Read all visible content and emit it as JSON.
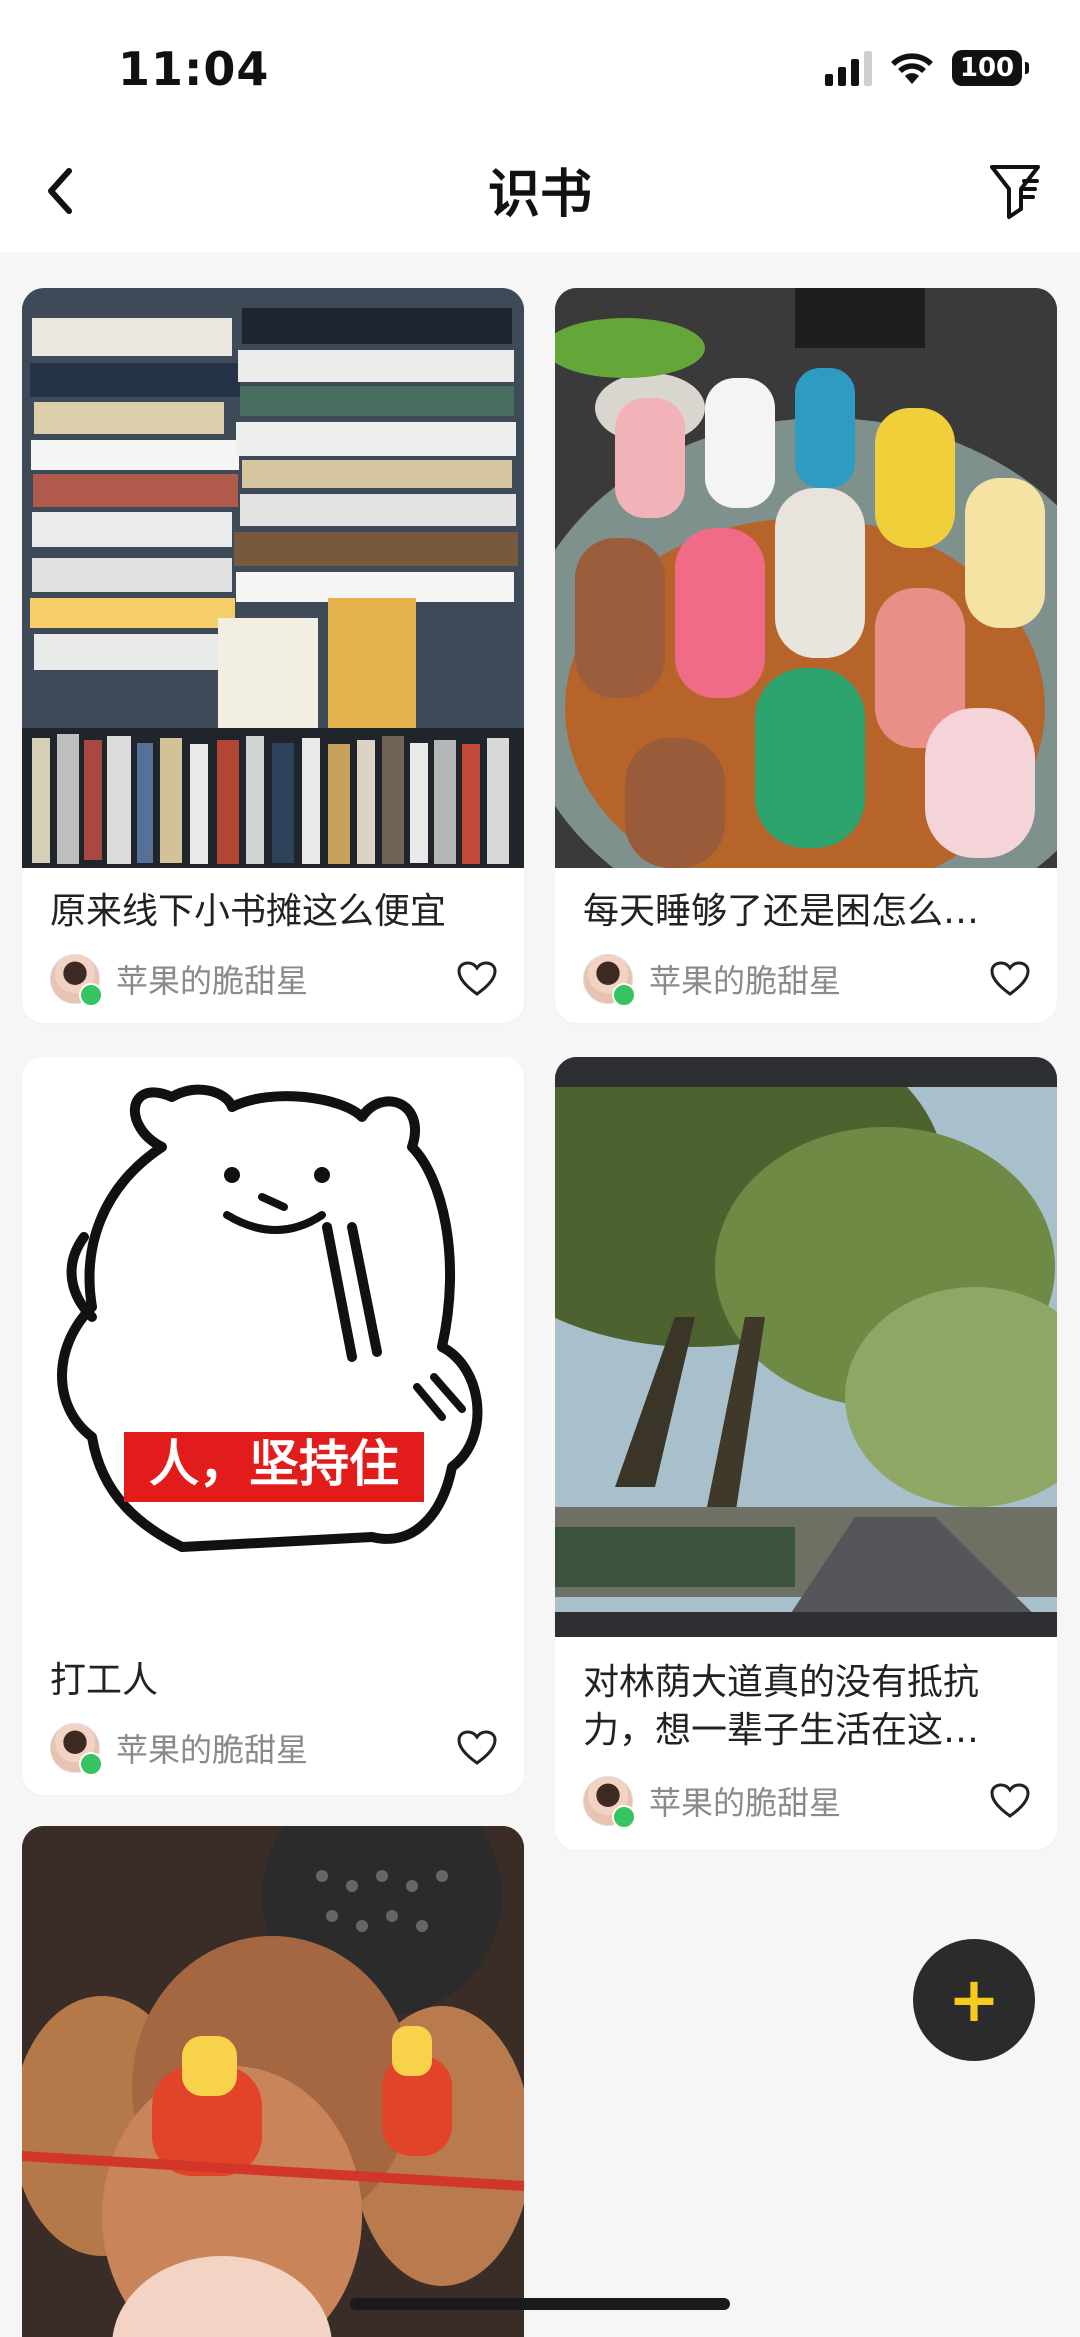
{
  "status_bar": {
    "time": "11:04",
    "battery": "100"
  },
  "nav": {
    "title": "识书",
    "back_icon": "chevron-left-icon",
    "filter_icon": "filter-icon"
  },
  "feed": {
    "cards": [
      {
        "title": "原来线下小书摊这么便宜",
        "author": "苹果的脆甜星",
        "image": "books-photo"
      },
      {
        "title": "每天睡够了还是困怎么…",
        "author": "苹果的脆甜星",
        "image": "vases-photo"
      },
      {
        "title": "打工人",
        "author": "苹果的脆甜星",
        "image": "bear-sticker",
        "image_caption": "人，坚持住"
      },
      {
        "title": "对林荫大道真的没有抵抗力，想一辈子生活在这…",
        "author": "苹果的脆甜星",
        "image": "tree-road-photo"
      },
      {
        "title": "",
        "author": "",
        "image": "plush-toys-photo"
      }
    ]
  },
  "fab": {
    "label": "+",
    "icon": "plus-icon",
    "accent": "#f5cc1d"
  }
}
